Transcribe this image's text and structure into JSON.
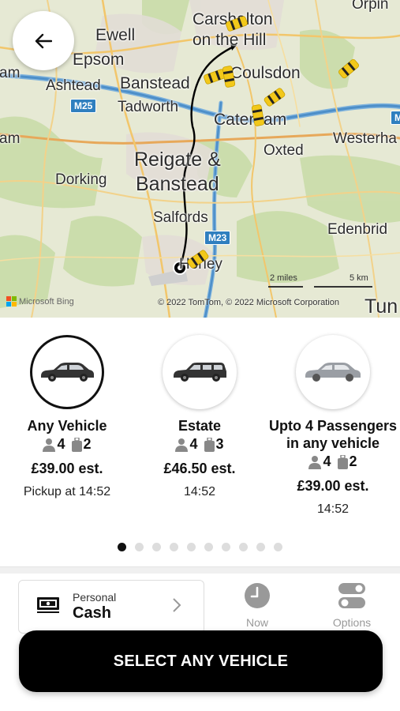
{
  "map": {
    "towns": {
      "carshalton": "Carshalton",
      "carshalton_hill": "on the Hill",
      "ewell": "Ewell",
      "epsom": "Epsom",
      "ashtead": "Ashtead",
      "banstead": "Banstead",
      "coulsdon": "Coulsdon",
      "tadworth": "Tadworth",
      "caterham": "Caterham",
      "reigate": "Reigate &",
      "banstead2": "Banstead",
      "oxted": "Oxted",
      "westerham": "Westerha",
      "dorking": "Dorking",
      "salfords": "Salfords",
      "horley": "Horley",
      "edenbridge": "Edenbrid",
      "orpington": "Orpin",
      "cham": "am",
      "ham2": "am",
      "tun": "Tun"
    },
    "roads": {
      "m25": "M25",
      "m23": "M23",
      "m25b": "M"
    },
    "scale_miles": "2 miles",
    "scale_km": "5 km",
    "provider": "Microsoft Bing",
    "copyright": "© 2022 TomTom, © 2022 Microsoft Corporation"
  },
  "vehicles": [
    {
      "name": "Any Vehicle",
      "passengers": "4",
      "luggage": "2",
      "price": "£39.00 est.",
      "time": "Pickup at 14:52",
      "selected": true
    },
    {
      "name": "Estate",
      "passengers": "4",
      "luggage": "3",
      "price": "£46.50 est.",
      "time": "14:52",
      "selected": false
    },
    {
      "name": "Upto 4 Passengers in any vehicle",
      "name_line1": "Upto 4 Passengers",
      "name_line2": "in any vehicle",
      "passengers": "4",
      "luggage": "2",
      "price": "£39.00 est.",
      "time": "14:52",
      "selected": false
    }
  ],
  "pager": {
    "count": 10,
    "active": 0
  },
  "payment": {
    "subtitle": "Personal",
    "method": "Cash"
  },
  "time_option": {
    "label": "Now"
  },
  "options_option": {
    "label": "Options"
  },
  "cta": {
    "label": "SELECT ANY VEHICLE"
  },
  "colors": {
    "accent": "#000000",
    "taxi": "#f2c81a",
    "route": "#000000",
    "road_badge": "#2f7fbf"
  }
}
